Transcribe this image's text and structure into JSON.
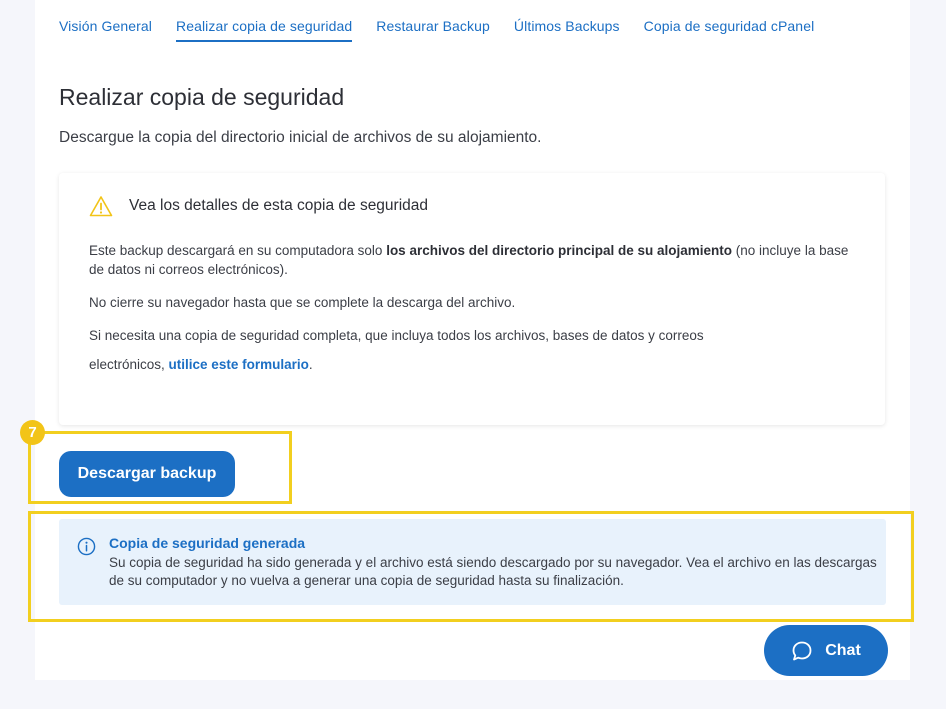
{
  "tabs": [
    {
      "label": "Visión General"
    },
    {
      "label": "Realizar copia de seguridad"
    },
    {
      "label": "Restaurar Backup"
    },
    {
      "label": "Últimos Backups"
    },
    {
      "label": "Copia de seguridad cPanel"
    }
  ],
  "page": {
    "title": "Realizar copia de seguridad",
    "description": "Descargue la copia del directorio inicial de archivos de su alojamiento."
  },
  "details": {
    "title": "Vea los detalles de esta copia de seguridad",
    "p1_before": "Este backup descargará en su computadora solo ",
    "p1_bold": "los archivos del directorio principal de su alojamiento",
    "p1_after": " (no incluye la base de datos ni correos electrónicos).",
    "p2": "No cierre su navegador hasta que se complete la descarga del archivo.",
    "p3_line1": "Si necesita una copia de seguridad completa, que incluya todos los archivos, bases de datos y correos",
    "p3_line2_before": "electrónicos, ",
    "p3_link": "utilice este formulario",
    "p3_after": "."
  },
  "step": {
    "number": "7"
  },
  "download_button": {
    "label": "Descargar backup"
  },
  "alert": {
    "title": "Copia de seguridad generada",
    "text": "Su copia de seguridad ha sido generada y el archivo está siendo descargado por su navegador. Vea el archivo en las descargas de su computador y no vuelva a generar una copia de seguridad hasta su finalización."
  },
  "chat": {
    "label": "Chat"
  },
  "icons": {
    "warning": "warning-triangle-icon",
    "info": "info-circle-icon",
    "chat": "chat-bubble-icon"
  },
  "colors": {
    "accent": "#1c6fc4",
    "highlight": "#f2cf1f",
    "alert_bg": "#e8f2fc"
  }
}
